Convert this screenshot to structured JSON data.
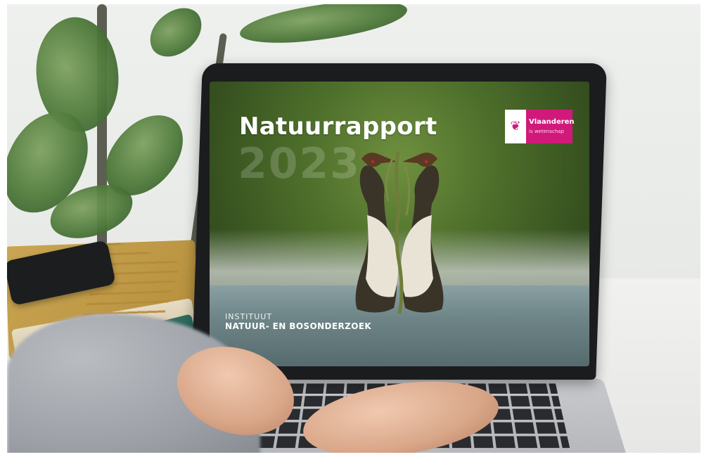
{
  "laptop_screen": {
    "title": "Natuurrapport",
    "year": "2023",
    "institute_line1": "INSTITUUT",
    "institute_line2": "NATUUR- EN BOSONDERZOEK",
    "logo": {
      "name": "Vlaanderen",
      "subtitle": "is wetenschap",
      "brand_color": "#d0197a",
      "icon": "flemish-lion-icon"
    }
  },
  "colors": {
    "screen_green": "#4e6f2b",
    "bezel": "#1b1c1e",
    "logo_pink": "#d0197a"
  }
}
